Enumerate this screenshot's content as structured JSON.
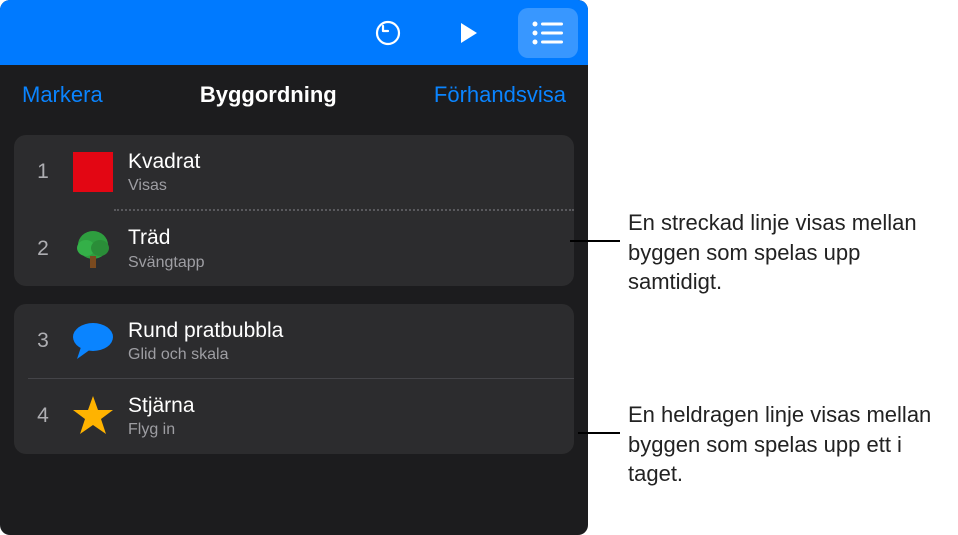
{
  "tabs": {
    "markera": "Markera",
    "byggordning": "Byggordning",
    "forhandsvisa": "Förhandsvisa"
  },
  "builds": [
    {
      "num": "1",
      "title": "Kvadrat",
      "sub": "Visas"
    },
    {
      "num": "2",
      "title": "Träd",
      "sub": "Svängtapp"
    },
    {
      "num": "3",
      "title": "Rund pratbubbla",
      "sub": "Glid och skala"
    },
    {
      "num": "4",
      "title": "Stjärna",
      "sub": "Flyg in"
    }
  ],
  "callouts": {
    "dotted": "En streckad linje visas mellan byggen som spelas upp samtidigt.",
    "solid": "En heldragen linje visas mellan byggen som spelas upp ett i taget."
  }
}
